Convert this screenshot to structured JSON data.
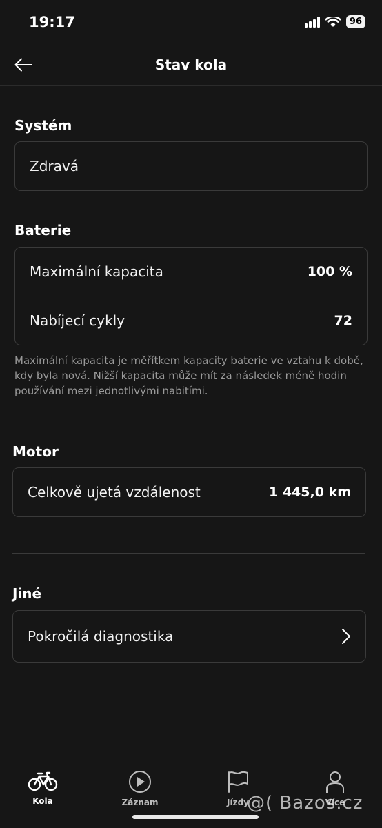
{
  "status_bar": {
    "time": "19:17",
    "battery": "96"
  },
  "nav": {
    "title": "Stav kola"
  },
  "system": {
    "title": "Systém",
    "status": "Zdravá"
  },
  "battery": {
    "title": "Baterie",
    "rows": [
      {
        "label": "Maximální kapacita",
        "value": "100 %"
      },
      {
        "label": "Nabíjecí cykly",
        "value": "72"
      }
    ],
    "note": "Maximální kapacita je měřítkem kapacity baterie ve vztahu k době, kdy byla nová. Nižší kapacita může mít za následek méně hodin používání mezi jednotlivými nabitími."
  },
  "motor": {
    "title": "Motor",
    "rows": [
      {
        "label": "Celkově ujetá vzdálenost",
        "value": "1 445,0 km"
      }
    ]
  },
  "other": {
    "title": "Jiné",
    "rows": [
      {
        "label": "Pokročilá diagnostika",
        "icon": "chevron-right-icon"
      }
    ]
  },
  "tabs": [
    {
      "label": "Kola",
      "icon": "bike-icon",
      "active": true
    },
    {
      "label": "Záznam",
      "icon": "play-circle-icon",
      "active": false
    },
    {
      "label": "Jízdy",
      "icon": "flag-icon",
      "active": false
    },
    {
      "label": "Více",
      "icon": "person-icon",
      "active": false
    }
  ],
  "watermark": "@( Bazos.cz"
}
